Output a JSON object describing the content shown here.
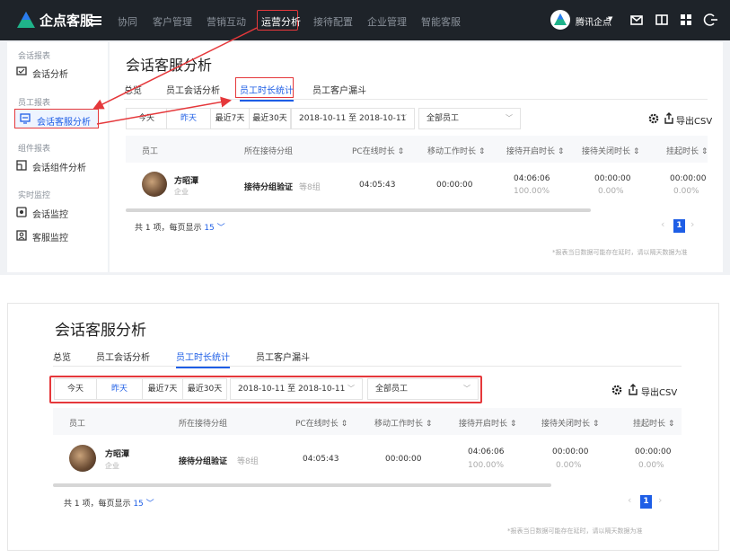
{
  "app": {
    "name": "企点客服"
  },
  "nav": {
    "items": [
      "协同",
      "客户管理",
      "营销互动",
      "运营分析",
      "接待配置",
      "企业管理",
      "智能客服"
    ],
    "active": "运营分析",
    "brand": "腾讯企点"
  },
  "sidebar": {
    "groups": [
      {
        "title": "会话报表",
        "items": [
          {
            "label": "会话分析",
            "icon": "chat-square-icon"
          }
        ]
      },
      {
        "title": "员工报表",
        "items": [
          {
            "label": "会话客服分析",
            "icon": "agent-chat-icon",
            "active": true
          }
        ]
      },
      {
        "title": "组件报表",
        "items": [
          {
            "label": "会话组件分析",
            "icon": "component-icon"
          }
        ]
      },
      {
        "title": "实时监控",
        "items": [
          {
            "label": "会话监控",
            "icon": "monitor-icon"
          },
          {
            "label": "客服监控",
            "icon": "agent-monitor-icon"
          }
        ]
      }
    ]
  },
  "page": {
    "title": "会话客服分析",
    "tabs": [
      "总览",
      "员工会话分析",
      "员工时长统计",
      "员工客户漏斗"
    ],
    "active_tab": "员工时长统计"
  },
  "filters": {
    "buttons": [
      "今天",
      "昨天",
      "最近7天",
      "最近30天"
    ],
    "active": "昨天",
    "date_range": "2018-10-11 至 2018-10-11",
    "staff": "全部员工"
  },
  "tools": {
    "export": "导出CSV"
  },
  "table": {
    "columns": [
      "员工",
      "所在接待分组",
      "PC在线时长",
      "移动工作时长",
      "接待开启时长",
      "接待关闭时长",
      "挂起时长"
    ],
    "rows": [
      {
        "name": "方昭潭",
        "role": "企业",
        "group": "接待分组验证",
        "group_more": "等8组",
        "pc": "04:05:43",
        "mobile": "00:00:00",
        "open": "04:06:06",
        "open_pct": "100.00%",
        "close": "00:00:00",
        "close_pct": "0.00%",
        "hang": "00:00:00",
        "hang_pct": "0.00%"
      }
    ]
  },
  "pagination": {
    "total_prefix": "共 1 项，每页显示",
    "page_size": "15",
    "current": "1"
  },
  "footnote": "*报表当日数据可能存在延时，请以隔天数据为准",
  "colors": {
    "primary": "#1e5ee6",
    "highlight": "#e5383b",
    "nav_bg": "#1e2329"
  }
}
